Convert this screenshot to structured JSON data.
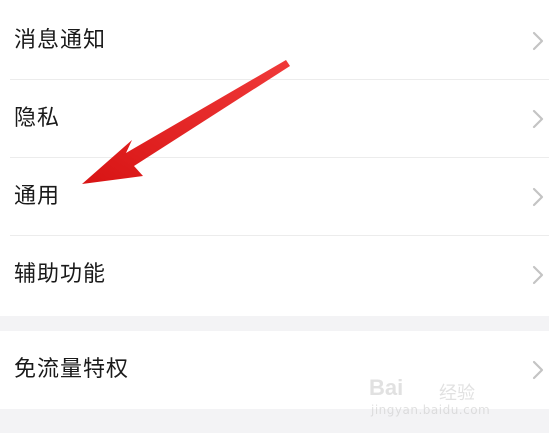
{
  "settings": {
    "group1": [
      {
        "label": "消息通知",
        "chevron": "chevron-right-icon"
      },
      {
        "label": "隐私",
        "chevron": "chevron-right-icon"
      },
      {
        "label": "通用",
        "chevron": "chevron-right-icon"
      },
      {
        "label": "辅助功能",
        "chevron": "chevron-right-icon"
      }
    ],
    "group2": [
      {
        "label": "免流量特权",
        "chevron": "chevron-right-icon"
      }
    ]
  },
  "annotation": {
    "arrow_color": "#e21b1b",
    "target": "通用"
  },
  "watermark": {
    "brand": "Bai",
    "sub": "经验",
    "url": "jingyan.baidu.com"
  },
  "colors": {
    "background": "#f3f3f5",
    "row_background": "#ffffff",
    "text": "#1a1a1a",
    "chevron": "#c4c4c4",
    "divider": "#ececec"
  }
}
